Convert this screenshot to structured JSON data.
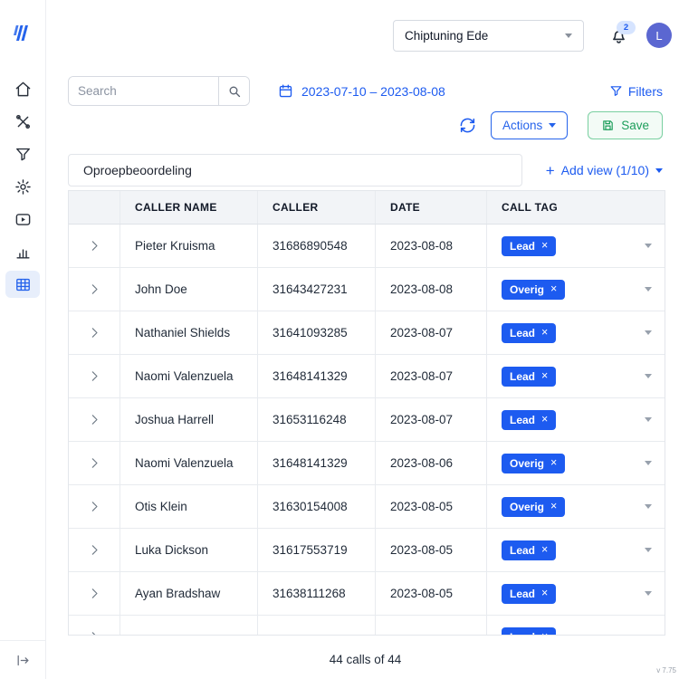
{
  "brand": {
    "logo_icon": "triple-slash-logo",
    "accent_blue": "#1d5bf0",
    "save_green": "#1d9e5b"
  },
  "header": {
    "company_selector": {
      "value": "Chiptuning Ede",
      "caret_icon": "chevron-down-icon"
    },
    "notifications": {
      "icon": "bell-icon",
      "badge_count": "2"
    },
    "avatar": {
      "initial": "L"
    }
  },
  "sidebar": {
    "items": [
      {
        "icon": "home-icon",
        "active": false
      },
      {
        "icon": "tools-icon",
        "active": false
      },
      {
        "icon": "funnel-icon",
        "active": false
      },
      {
        "icon": "gear-icon",
        "active": false
      },
      {
        "icon": "video-icon",
        "active": false
      },
      {
        "icon": "stats-icon",
        "active": false
      },
      {
        "icon": "table-icon",
        "active": true
      }
    ],
    "collapse_icon": "collapse-sidebar-icon"
  },
  "toolbar": {
    "search": {
      "placeholder": "Search",
      "icon": "search-icon"
    },
    "date_range": {
      "icon": "calendar-icon",
      "value": "2023-07-10 – 2023-08-08"
    },
    "filters_label": "Filters",
    "filters_icon": "filter-funnel-icon",
    "refresh_icon": "refresh-icon",
    "actions_label": "Actions",
    "save_label": "Save",
    "save_icon": "floppy-disk-icon"
  },
  "views": {
    "active_view": "Oproepbeoordeling",
    "add_view_plus": "+",
    "add_view_label": "Add view (1/10)"
  },
  "table": {
    "columns": [
      "CALLER NAME",
      "CALLER",
      "DATE",
      "CALL TAG"
    ],
    "tag_color": "#1d5bf0",
    "remove_tag_glyph": "×",
    "rows": [
      {
        "name": "Pieter Kruisma",
        "caller": "31686890548",
        "date": "2023-08-08",
        "tag": "Lead"
      },
      {
        "name": "John Doe",
        "caller": "31643427231",
        "date": "2023-08-08",
        "tag": "Overig"
      },
      {
        "name": "Nathaniel Shields",
        "caller": "31641093285",
        "date": "2023-08-07",
        "tag": "Lead"
      },
      {
        "name": "Naomi Valenzuela",
        "caller": "31648141329",
        "date": "2023-08-07",
        "tag": "Lead"
      },
      {
        "name": "Joshua Harrell",
        "caller": "31653116248",
        "date": "2023-08-07",
        "tag": "Lead"
      },
      {
        "name": "Naomi Valenzuela",
        "caller": "31648141329",
        "date": "2023-08-06",
        "tag": "Overig"
      },
      {
        "name": "Otis Klein",
        "caller": "31630154008",
        "date": "2023-08-05",
        "tag": "Overig"
      },
      {
        "name": "Luka Dickson",
        "caller": "31617553719",
        "date": "2023-08-05",
        "tag": "Lead"
      },
      {
        "name": "Ayan Bradshaw",
        "caller": "31638111268",
        "date": "2023-08-05",
        "tag": "Lead"
      },
      {
        "name": "",
        "caller": "",
        "date": "",
        "tag": "Lead"
      }
    ]
  },
  "footer": {
    "summary": "44 calls of 44",
    "version": "v 7.75"
  }
}
